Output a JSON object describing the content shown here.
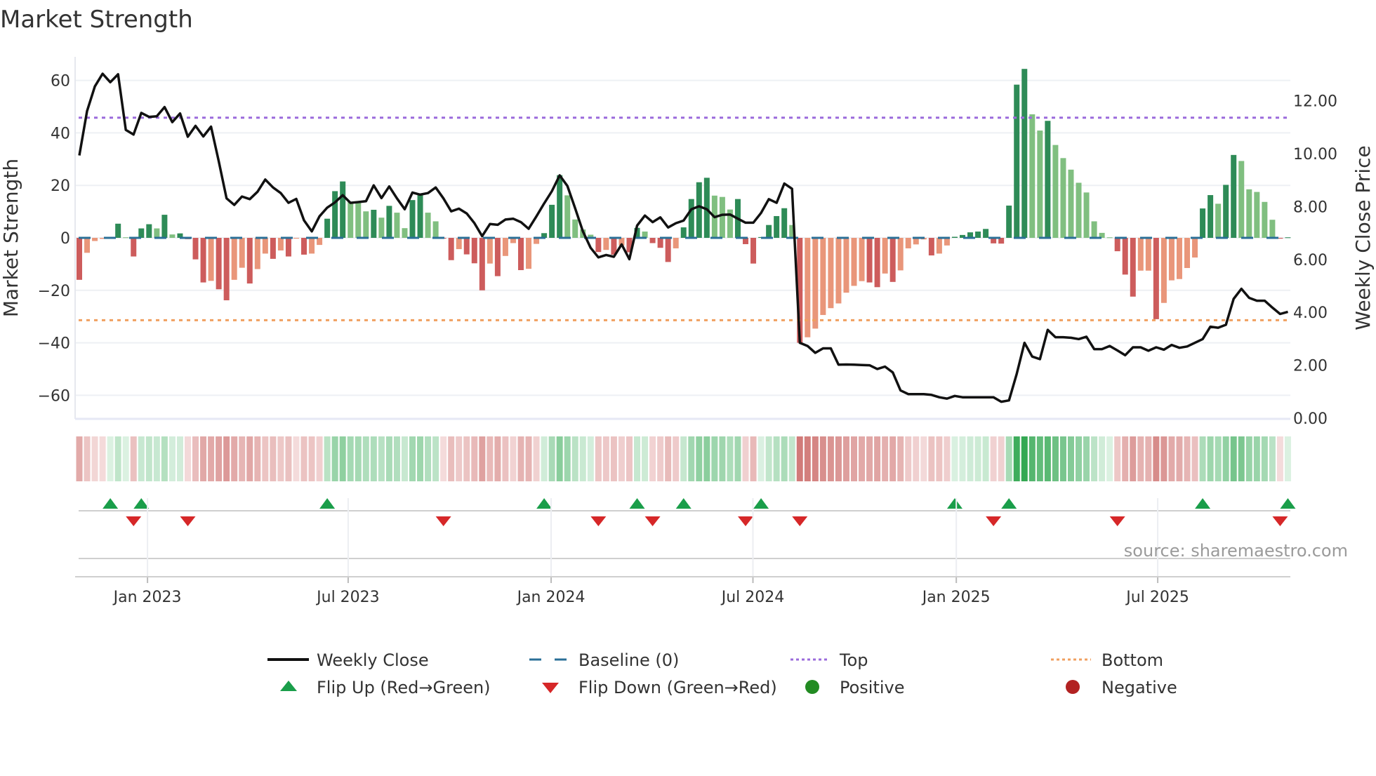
{
  "chart_data": {
    "type": "bar",
    "title": "Market Strength",
    "ylabel": "Market Strength",
    "ylabel_right": "Weekly Close Price",
    "ylim": [
      -69,
      69
    ],
    "ylim_right": [
      0,
      13.66
    ],
    "y_ticks": [
      {
        "value": 60,
        "label": "60"
      },
      {
        "value": 40,
        "label": "40"
      },
      {
        "value": 20,
        "label": "20"
      },
      {
        "value": 0,
        "label": "0"
      },
      {
        "value": -20,
        "label": "−20"
      },
      {
        "value": -40,
        "label": "−40"
      },
      {
        "value": -60,
        "label": "−60"
      }
    ],
    "y_ticks_right": [
      {
        "value": 12,
        "label": "12.00"
      },
      {
        "value": 10,
        "label": "10.00"
      },
      {
        "value": 8,
        "label": "8.00"
      },
      {
        "value": 6,
        "label": "6.00"
      },
      {
        "value": 4,
        "label": "4.00"
      },
      {
        "value": 2,
        "label": "2.00"
      },
      {
        "value": 0,
        "label": "0.00"
      }
    ],
    "x_ticks": [
      {
        "week": 9.8,
        "label": "Jan 2023"
      },
      {
        "week": 35.7,
        "label": "Jul 2023"
      },
      {
        "week": 61.9,
        "label": "Jan 2024"
      },
      {
        "week": 87.95,
        "label": "Jul 2024"
      },
      {
        "week": 114.2,
        "label": "Jan 2025"
      },
      {
        "week": 140.2,
        "label": "Jul 2025"
      }
    ],
    "top_level": 45.8,
    "bottom_level": -31.4,
    "strength": [
      -16,
      -5.7,
      -1.2,
      -0.4,
      0.2,
      5.4,
      0.2,
      -7.1,
      3.6,
      5.2,
      3.6,
      8.8,
      1.3,
      1.7,
      -0.5,
      -8.2,
      -17,
      -16.4,
      -19.6,
      -23.8,
      -16,
      -11.4,
      -17.4,
      -11.9,
      -6,
      -8,
      -4.8,
      -7.1,
      -0.3,
      -6.4,
      -6,
      -2.7,
      7.3,
      17.8,
      21.5,
      13.7,
      13.5,
      10.1,
      10.7,
      7.7,
      12.2,
      9.6,
      3.7,
      14.4,
      16.3,
      9.6,
      6.3,
      -0.3,
      -8.5,
      -4.3,
      -6.3,
      -9.7,
      -20,
      -9.8,
      -14.6,
      -6.9,
      -2,
      -12.3,
      -11.8,
      -2.3,
      1.8,
      12.6,
      23.9,
      16.2,
      7,
      3.2,
      1.2,
      -5.4,
      -4.6,
      -6.4,
      -2.9,
      -5.5,
      3.8,
      2.4,
      -2,
      -3.8,
      -9.2,
      -4,
      4,
      14.8,
      21.2,
      22.9,
      16.1,
      15.6,
      10.8,
      14.8,
      -2.4,
      -9.8,
      0.3,
      4.9,
      8.3,
      11.3,
      4.9,
      -40,
      -37.9,
      -34.6,
      -29.4,
      -26.8,
      -25,
      -20.9,
      -18.3,
      -16.5,
      -17,
      -18.8,
      -13.6,
      -16.8,
      -12.4,
      -4,
      -2.5,
      -0.6,
      -6.7,
      -6,
      -2.9,
      0.4,
      1.1,
      2.1,
      2.4,
      3.4,
      -2.1,
      -2.2,
      12.3,
      58.4,
      64.4,
      47.1,
      40.9,
      44.6,
      35.4,
      30.4,
      26,
      21,
      17.3,
      6.3,
      1.9,
      0.2,
      -5.1,
      -14,
      -22.4,
      -12.5,
      -12.5,
      -31,
      -24.8,
      -16.2,
      -15.7,
      -11.5,
      -7.5,
      11.2,
      16.3,
      13,
      20.2,
      31.6,
      29.3,
      18.5,
      17.5,
      13.7,
      6.9,
      -0.3,
      0.2
    ],
    "weekly_close": [
      9.93,
      11.61,
      12.54,
      13.02,
      12.7,
      13.0,
      10.9,
      10.72,
      11.54,
      11.39,
      11.41,
      11.76,
      11.19,
      11.52,
      10.64,
      11.05,
      10.65,
      11.02,
      9.71,
      8.31,
      8.06,
      8.38,
      8.28,
      8.56,
      9.02,
      8.72,
      8.51,
      8.14,
      8.29,
      7.48,
      7.06,
      7.63,
      7.96,
      8.16,
      8.43,
      8.14,
      8.17,
      8.2,
      8.8,
      8.32,
      8.76,
      8.31,
      7.9,
      8.53,
      8.45,
      8.51,
      8.72,
      8.31,
      7.82,
      7.92,
      7.74,
      7.37,
      6.88,
      7.34,
      7.31,
      7.51,
      7.54,
      7.41,
      7.16,
      7.63,
      8.12,
      8.58,
      9.18,
      8.78,
      7.94,
      7.06,
      6.44,
      6.08,
      6.17,
      6.1,
      6.57,
      6.01,
      7.28,
      7.66,
      7.41,
      7.59,
      7.21,
      7.37,
      7.47,
      7.9,
      8.01,
      7.9,
      7.6,
      7.69,
      7.7,
      7.54,
      7.39,
      7.39,
      7.76,
      8.28,
      8.14,
      8.87,
      8.67,
      2.85,
      2.73,
      2.47,
      2.64,
      2.64,
      2.02,
      2.03,
      2.02,
      2.01,
      2.0,
      1.86,
      1.95,
      1.73,
      1.05,
      0.91,
      0.91,
      0.91,
      0.88,
      0.79,
      0.74,
      0.84,
      0.79,
      0.79,
      0.79,
      0.79,
      0.79,
      0.62,
      0.67,
      1.67,
      2.85,
      2.33,
      2.23,
      3.34,
      3.06,
      3.06,
      3.04,
      2.99,
      3.08,
      2.61,
      2.61,
      2.73,
      2.56,
      2.38,
      2.68,
      2.68,
      2.55,
      2.68,
      2.59,
      2.77,
      2.66,
      2.71,
      2.85,
      2.99,
      3.46,
      3.42,
      3.53,
      4.51,
      4.89,
      4.55,
      4.44,
      4.44,
      4.18,
      3.94,
      4.02
    ],
    "flip_up_weeks": [
      5,
      9,
      33,
      61,
      73,
      79,
      89,
      114,
      121,
      146,
      157
    ],
    "flip_down_weeks": [
      8,
      15,
      48,
      68,
      75,
      87,
      94,
      119,
      135,
      156
    ],
    "legend": {
      "placement": "bottom",
      "weekly_close": "Weekly Close",
      "baseline": "Baseline (0)",
      "top": "Top",
      "bottom": "Bottom",
      "flip_up": "Flip Up (Red→Green)",
      "flip_down": "Flip Down (Green→Red)",
      "positive": "Positive",
      "negative": "Negative"
    },
    "source": "source: sharemaestro.com"
  },
  "colors": {
    "green_dark": "#2e8b57",
    "green_light": "#80bf80",
    "red_dark": "#cd5c5c",
    "red_light": "#e9967a",
    "baseline": "#2a6f97",
    "top": "#9b6bdc",
    "bottom": "#f0a060",
    "flip_up": "#1a9e4a",
    "flip_down": "#d62728",
    "positive": "#228b22",
    "negative": "#b22222",
    "price_line": "#111111"
  }
}
